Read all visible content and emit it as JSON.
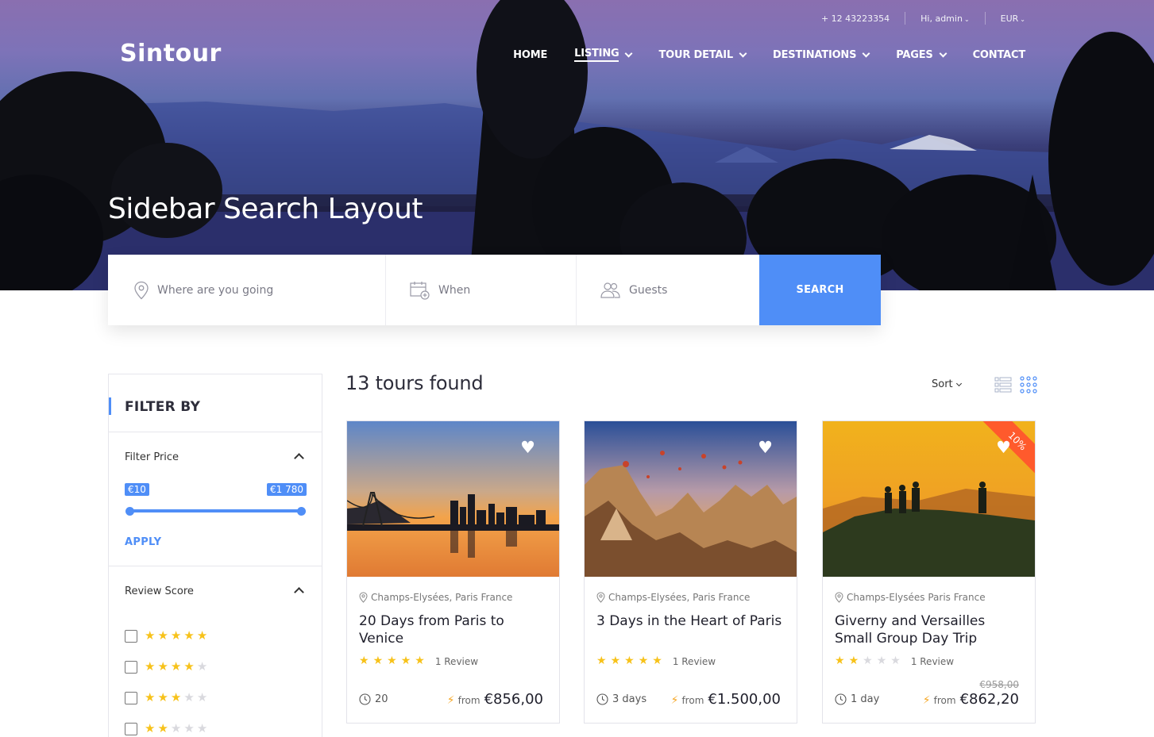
{
  "topbar": {
    "phone": "+ 12 43223354",
    "user": "Hi, admin",
    "currency": "EUR"
  },
  "brand": {
    "logo": "Sintour"
  },
  "nav": [
    {
      "label": "HOME",
      "dropdown": false,
      "active": false
    },
    {
      "label": "LISTING",
      "dropdown": true,
      "active": true
    },
    {
      "label": "TOUR DETAIL",
      "dropdown": true,
      "active": false
    },
    {
      "label": "DESTINATIONS",
      "dropdown": true,
      "active": false
    },
    {
      "label": "PAGES",
      "dropdown": true,
      "active": false
    },
    {
      "label": "CONTACT",
      "dropdown": false,
      "active": false
    }
  ],
  "hero": {
    "title": "Sidebar Search Layout"
  },
  "search": {
    "where_placeholder": "Where are you going",
    "when_placeholder": "When",
    "guests_placeholder": "Guests",
    "button": "SEARCH",
    "icons": {
      "where": "map-pin-icon",
      "when": "calendar-add-icon",
      "guests": "users-icon"
    }
  },
  "sidebar": {
    "title": "FILTER BY",
    "price": {
      "title": "Filter Price",
      "min": "€10",
      "max": "€1 780",
      "apply": "APPLY",
      "range_fraction": [
        0,
        1
      ]
    },
    "review": {
      "title": "Review Score",
      "options": [
        5,
        4,
        3,
        2
      ]
    }
  },
  "results": {
    "count_text": "13 tours found",
    "sort_label": "Sort",
    "view": "grid"
  },
  "cards": [
    {
      "location": "Champs-Elysées, Paris France",
      "title": "20 Days from Paris to Venice",
      "stars": 5,
      "reviews": "1 Review",
      "duration": "20",
      "from": "from",
      "price": "€856,00",
      "old_price": "",
      "discount": "",
      "favorite": true
    },
    {
      "location": "Champs-Elysées, Paris France",
      "title": "3 Days in the Heart of Paris",
      "stars": 5,
      "reviews": "1 Review",
      "duration": "3 days",
      "from": "from",
      "price": "€1.500,00",
      "old_price": "",
      "discount": "",
      "favorite": true
    },
    {
      "location": "Champs-Elysées Paris France",
      "title": "Giverny and Versailles Small Group Day Trip",
      "stars": 2,
      "reviews": "1 Review",
      "duration": "1 day",
      "from": "from",
      "price": "€862,20",
      "old_price": "€958,00",
      "discount": "10%",
      "favorite": true
    }
  ],
  "colors": {
    "accent": "#4f8ef7",
    "star": "#f7c21a",
    "discount": "#ff5a2c",
    "bolt": "#f5a623"
  }
}
